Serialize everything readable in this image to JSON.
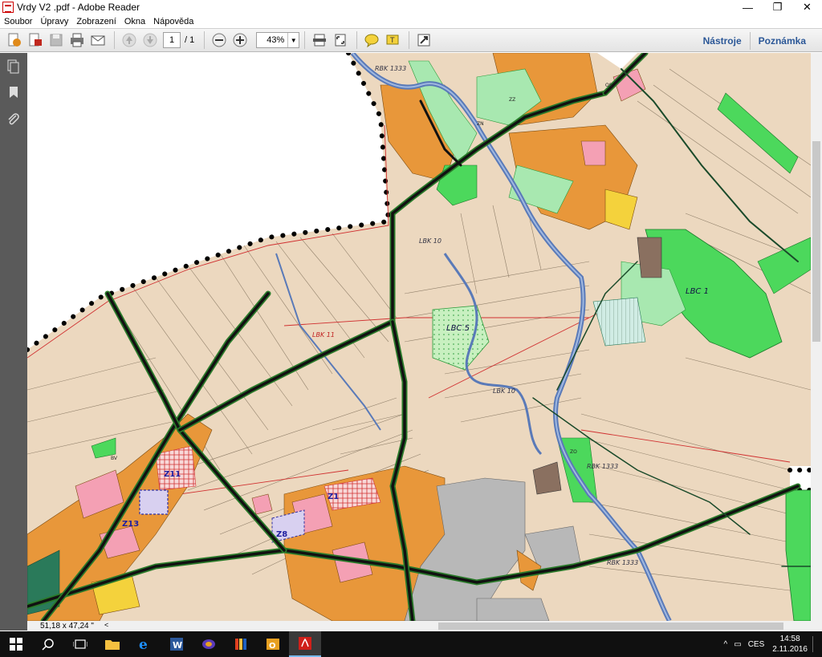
{
  "window": {
    "title": "Vrdy V2 .pdf - Adobe Reader",
    "minimize": "—",
    "restore": "❐",
    "close": "✕"
  },
  "menu": [
    "Soubor",
    "Úpravy",
    "Zobrazení",
    "Okna",
    "Nápověda"
  ],
  "toolbar": {
    "page_current": "1",
    "page_total": "/ 1",
    "zoom": "43%",
    "tools_label": "Nástroje",
    "comment_label": "Poznámka"
  },
  "status": {
    "dimensions": "51,18 x 47,24 \""
  },
  "map": {
    "labels": [
      "RBK 1333",
      "LBK 10",
      "LBC 1",
      "LBC 5",
      "LBK 10",
      "LBK 11",
      "RBK 1333",
      "RBK 1333",
      "Z11",
      "Z13",
      "Z8",
      "Z1",
      "OS",
      "BV",
      "ZN",
      "ZZ",
      "ZO"
    ]
  },
  "taskbar": {
    "time": "14:58",
    "date": "2.11.2016",
    "lang": "CES"
  },
  "colors": {
    "residential": "#e8973a",
    "agriculture": "#ecd8bf",
    "green": "#4cd85c",
    "industry": "#b8b8b8",
    "civic": "#f4a0b4",
    "water": "#6e90c8"
  }
}
